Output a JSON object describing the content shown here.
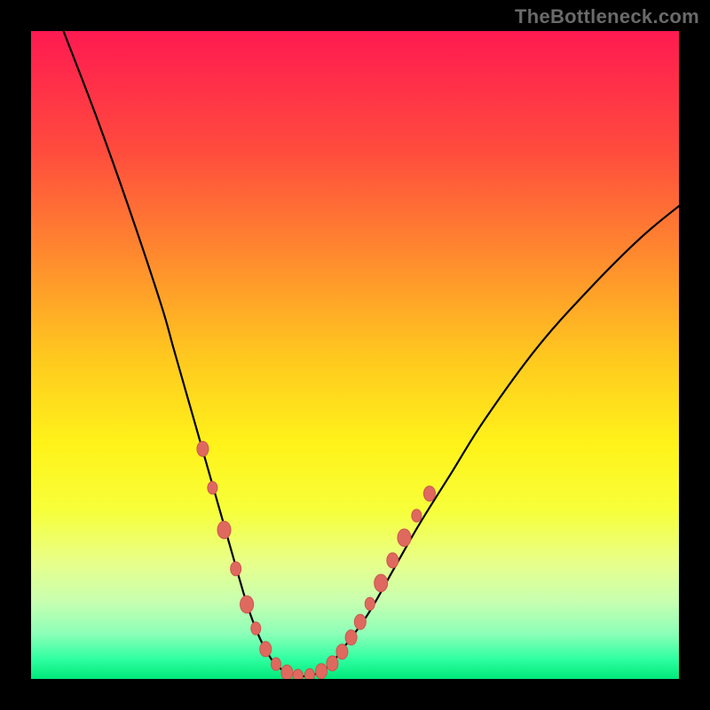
{
  "watermark": "TheBottleneck.com",
  "chart_data": {
    "type": "line",
    "title": "",
    "xlabel": "",
    "ylabel": "",
    "xlim": [
      0,
      100
    ],
    "ylim": [
      0,
      100
    ],
    "series": [
      {
        "name": "curve",
        "x": [
          5,
          10,
          15,
          20,
          22,
          24,
          26,
          28,
          30,
          32,
          33.5,
          35,
          36.5,
          38,
          40,
          42,
          44,
          46,
          48,
          52,
          56,
          60,
          65,
          70,
          78,
          86,
          94,
          100
        ],
        "y": [
          100,
          87,
          73,
          58,
          51,
          44,
          37,
          30,
          23,
          16,
          11,
          7,
          4,
          2,
          0.8,
          0.4,
          0.8,
          2,
          4.5,
          10,
          17,
          24,
          32,
          40,
          51,
          60,
          68,
          73
        ]
      }
    ],
    "markers": [
      {
        "x": 26.5,
        "y": 35.5,
        "size": 2.6
      },
      {
        "x": 28.0,
        "y": 29.5,
        "size": 2.2
      },
      {
        "x": 29.8,
        "y": 23.0,
        "size": 3.0
      },
      {
        "x": 31.6,
        "y": 17.0,
        "size": 2.4
      },
      {
        "x": 33.3,
        "y": 11.5,
        "size": 3.0
      },
      {
        "x": 34.7,
        "y": 7.8,
        "size": 2.2
      },
      {
        "x": 36.2,
        "y": 4.6,
        "size": 2.6
      },
      {
        "x": 37.8,
        "y": 2.3,
        "size": 2.2
      },
      {
        "x": 39.5,
        "y": 1.0,
        "size": 2.6
      },
      {
        "x": 41.2,
        "y": 0.5,
        "size": 2.2
      },
      {
        "x": 43.0,
        "y": 0.6,
        "size": 2.2
      },
      {
        "x": 44.8,
        "y": 1.2,
        "size": 2.6
      },
      {
        "x": 46.5,
        "y": 2.4,
        "size": 2.6
      },
      {
        "x": 48.0,
        "y": 4.2,
        "size": 2.6
      },
      {
        "x": 49.4,
        "y": 6.4,
        "size": 2.6
      },
      {
        "x": 50.8,
        "y": 8.8,
        "size": 2.6
      },
      {
        "x": 52.3,
        "y": 11.6,
        "size": 2.2
      },
      {
        "x": 54.0,
        "y": 14.8,
        "size": 3.0
      },
      {
        "x": 55.8,
        "y": 18.3,
        "size": 2.6
      },
      {
        "x": 57.6,
        "y": 21.8,
        "size": 3.0
      },
      {
        "x": 59.5,
        "y": 25.2,
        "size": 2.2
      },
      {
        "x": 61.5,
        "y": 28.6,
        "size": 2.6
      }
    ],
    "colors": {
      "curve": "#000000",
      "marker_fill": "#e0695f",
      "marker_stroke": "#c9564d"
    }
  }
}
